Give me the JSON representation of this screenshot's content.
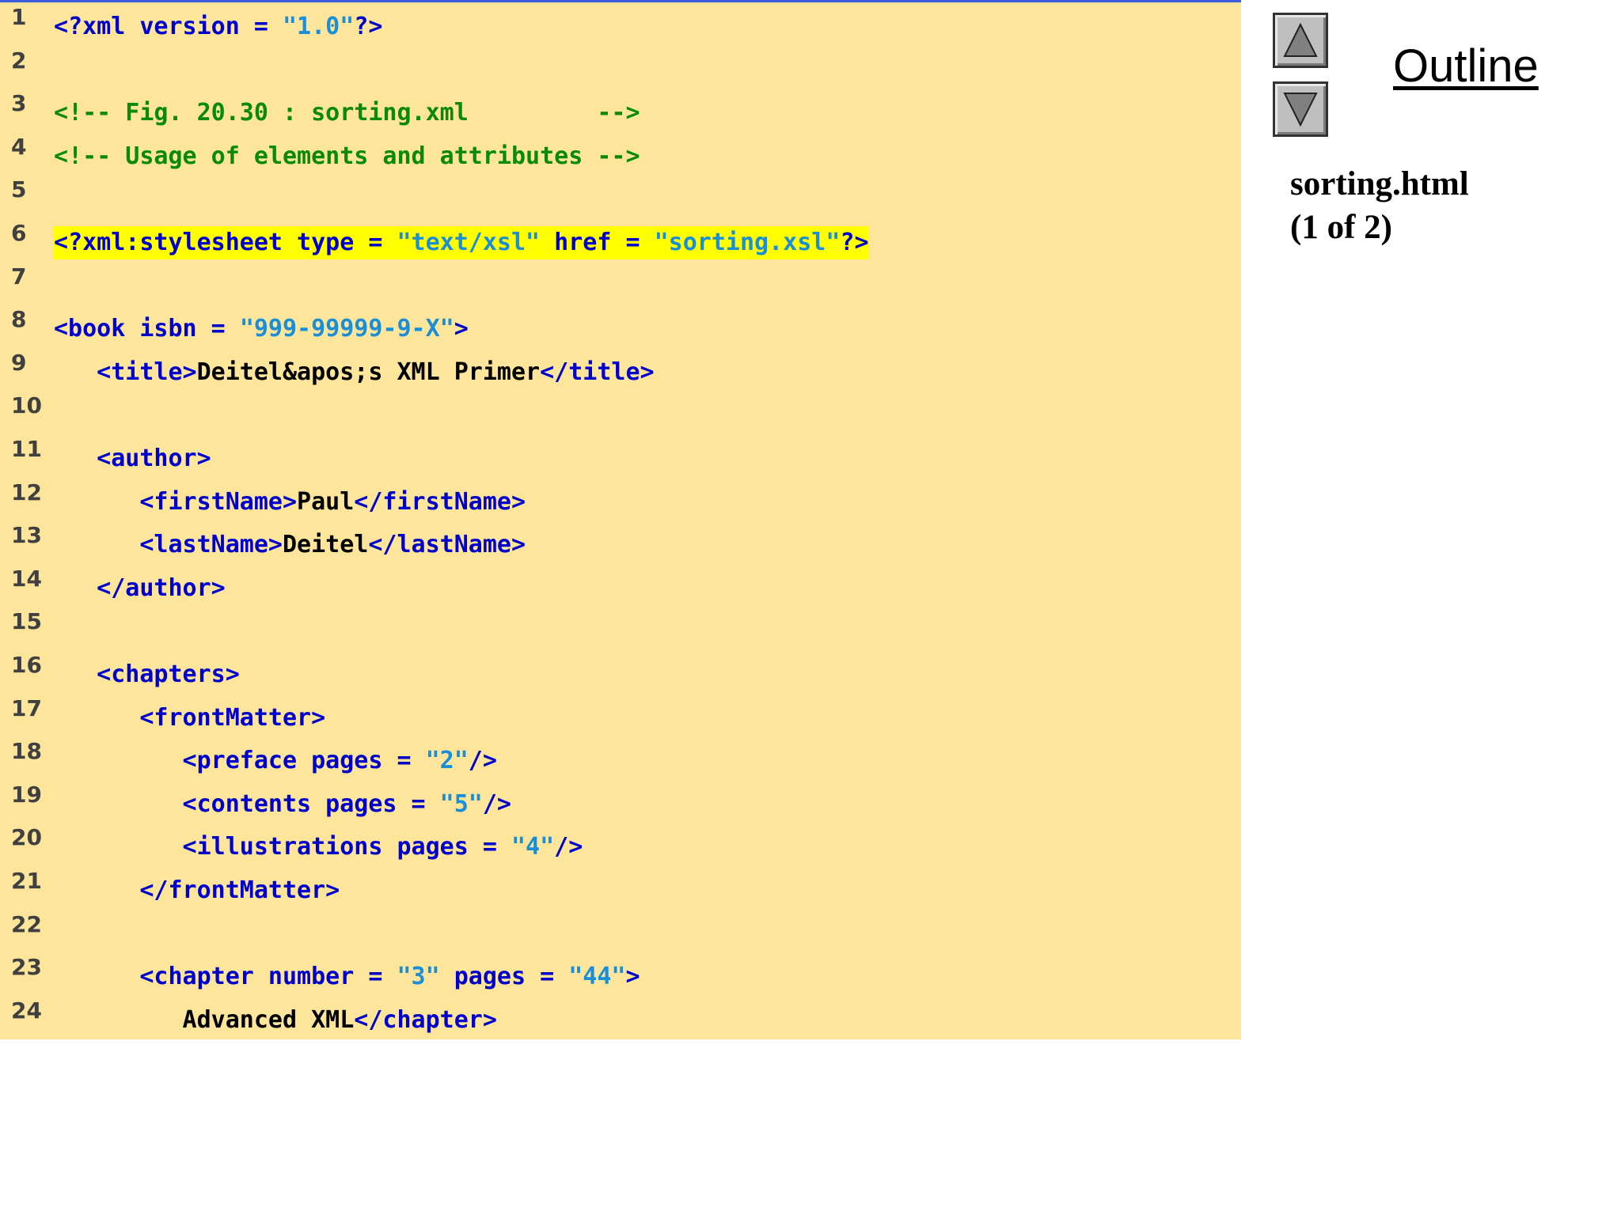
{
  "code_lines": [
    {
      "n": "1",
      "hl": false,
      "segs": [
        {
          "t": "<?xml version = ",
          "c": "tag"
        },
        {
          "t": "\"1.0\"",
          "c": "val"
        },
        {
          "t": "?>",
          "c": "tag"
        }
      ]
    },
    {
      "n": "2",
      "hl": false,
      "segs": []
    },
    {
      "n": "3",
      "hl": false,
      "segs": [
        {
          "t": "<!-- Fig. 20.30 : sorting.xml         -->",
          "c": "com"
        }
      ]
    },
    {
      "n": "4",
      "hl": false,
      "segs": [
        {
          "t": "<!-- Usage of elements and attributes -->",
          "c": "com"
        }
      ]
    },
    {
      "n": "5",
      "hl": false,
      "segs": []
    },
    {
      "n": "6",
      "hl": true,
      "segs": [
        {
          "t": "<?xml:stylesheet type = ",
          "c": "tag"
        },
        {
          "t": "\"text/xsl\"",
          "c": "val"
        },
        {
          "t": " href = ",
          "c": "tag"
        },
        {
          "t": "\"sorting.xsl\"",
          "c": "val"
        },
        {
          "t": "?>",
          "c": "tag"
        }
      ]
    },
    {
      "n": "7",
      "hl": false,
      "segs": []
    },
    {
      "n": "8",
      "hl": false,
      "segs": [
        {
          "t": "<book isbn = ",
          "c": "tag"
        },
        {
          "t": "\"999-99999-9-X\"",
          "c": "val"
        },
        {
          "t": ">",
          "c": "tag"
        }
      ]
    },
    {
      "n": "9",
      "hl": false,
      "segs": [
        {
          "t": "   <title>",
          "c": "tag"
        },
        {
          "t": "Deitel&apos;s XML Primer",
          "c": "txt"
        },
        {
          "t": "</title>",
          "c": "tag"
        }
      ]
    },
    {
      "n": "10",
      "hl": false,
      "segs": []
    },
    {
      "n": "11",
      "hl": false,
      "segs": [
        {
          "t": "   <author>",
          "c": "tag"
        }
      ]
    },
    {
      "n": "12",
      "hl": false,
      "segs": [
        {
          "t": "      <firstName>",
          "c": "tag"
        },
        {
          "t": "Paul",
          "c": "txt"
        },
        {
          "t": "</firstName>",
          "c": "tag"
        }
      ]
    },
    {
      "n": "13",
      "hl": false,
      "segs": [
        {
          "t": "      <lastName>",
          "c": "tag"
        },
        {
          "t": "Deitel",
          "c": "txt"
        },
        {
          "t": "</lastName>",
          "c": "tag"
        }
      ]
    },
    {
      "n": "14",
      "hl": false,
      "segs": [
        {
          "t": "   </author>",
          "c": "tag"
        }
      ]
    },
    {
      "n": "15",
      "hl": false,
      "segs": []
    },
    {
      "n": "16",
      "hl": false,
      "segs": [
        {
          "t": "   <chapters>",
          "c": "tag"
        }
      ]
    },
    {
      "n": "17",
      "hl": false,
      "segs": [
        {
          "t": "      <frontMatter>",
          "c": "tag"
        }
      ]
    },
    {
      "n": "18",
      "hl": false,
      "segs": [
        {
          "t": "         <preface pages = ",
          "c": "tag"
        },
        {
          "t": "\"2\"",
          "c": "val"
        },
        {
          "t": "/>",
          "c": "tag"
        }
      ]
    },
    {
      "n": "19",
      "hl": false,
      "segs": [
        {
          "t": "         <contents pages = ",
          "c": "tag"
        },
        {
          "t": "\"5\"",
          "c": "val"
        },
        {
          "t": "/>",
          "c": "tag"
        }
      ]
    },
    {
      "n": "20",
      "hl": false,
      "segs": [
        {
          "t": "         <illustrations pages = ",
          "c": "tag"
        },
        {
          "t": "\"4\"",
          "c": "val"
        },
        {
          "t": "/>",
          "c": "tag"
        }
      ]
    },
    {
      "n": "21",
      "hl": false,
      "segs": [
        {
          "t": "      </frontMatter>",
          "c": "tag"
        }
      ]
    },
    {
      "n": "22",
      "hl": false,
      "segs": []
    },
    {
      "n": "23",
      "hl": false,
      "segs": [
        {
          "t": "      <chapter number = ",
          "c": "tag"
        },
        {
          "t": "\"3\"",
          "c": "val"
        },
        {
          "t": " pages = ",
          "c": "tag"
        },
        {
          "t": "\"44\"",
          "c": "val"
        },
        {
          "t": ">",
          "c": "tag"
        }
      ]
    },
    {
      "n": "24",
      "hl": false,
      "segs": [
        {
          "t": "         Advanced XML",
          "c": "txt"
        },
        {
          "t": "</chapter>",
          "c": "tag"
        }
      ]
    }
  ],
  "sidebar": {
    "outline_label": "Outline",
    "file_name": "sorting.html",
    "page_indicator": "(1 of 2)",
    "prev_icon": "triangle-up-icon",
    "next_icon": "triangle-down-icon"
  },
  "colors": {
    "panel_bg": "#fde59b",
    "tag": "#0000cc",
    "value": "#1a8fd8",
    "comment": "#0a8a0a",
    "text": "#000000",
    "highlight": "#ffff00"
  }
}
